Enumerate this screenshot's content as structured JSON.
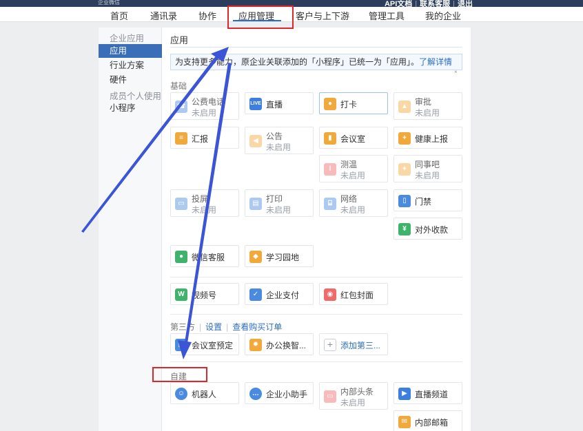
{
  "topbar": {
    "logo": "企业微信",
    "links": [
      "API文档",
      "联系客服",
      "退出"
    ]
  },
  "nav": {
    "items": [
      "首页",
      "通讯录",
      "协作",
      "应用管理",
      "客户与上下游",
      "管理工具",
      "我的企业"
    ],
    "active": "应用管理"
  },
  "sidebar": {
    "group1_header": "企业应用",
    "items1": [
      "应用",
      "行业方案",
      "硬件"
    ],
    "group2_header": "成员个人使用",
    "items2": [
      "小程序"
    ]
  },
  "main": {
    "title": "应用",
    "notice_text": "为支持更多能力，原企业关联添加的「小程序」已统一为「应用」。",
    "notice_link": "了解详情",
    "notice_close": "×",
    "section_basic": "基础",
    "basic_apps": [
      {
        "name": "公费电话",
        "status": "未启用",
        "icon": "phone-icon",
        "color": "#4a8be0"
      },
      {
        "name": "直播",
        "status": "",
        "icon": "live-icon",
        "color": "#3d7fe0"
      },
      {
        "name": "打卡",
        "status": "",
        "icon": "location-pin-icon",
        "color": "#f2a93b"
      },
      {
        "name": "审批",
        "status": "未启用",
        "icon": "approval-icon",
        "color": "#f2a93b"
      },
      {
        "name": "汇报",
        "status": "",
        "icon": "report-icon",
        "color": "#f2a93b"
      },
      {
        "name": "公告",
        "status": "未启用",
        "icon": "announcement-icon",
        "color": "#f2a93b"
      },
      {
        "name": "会议室",
        "status": "",
        "icon": "meeting-room-icon",
        "color": "#f2a93b"
      },
      {
        "name": "健康上报",
        "status": "",
        "icon": "health-icon",
        "color": "#f2a93b"
      },
      {
        "name": "测温",
        "status": "未启用",
        "icon": "thermometer-icon",
        "color": "#ef6b6b"
      },
      {
        "name": "同事吧",
        "status": "未启用",
        "icon": "colleagues-icon",
        "color": "#f2a93b"
      },
      {
        "name": "投屏",
        "status": "未启用",
        "icon": "screencast-icon",
        "color": "#4a8be0"
      },
      {
        "name": "打印",
        "status": "未启用",
        "icon": "printer-icon",
        "color": "#4a8be0"
      },
      {
        "name": "网络",
        "status": "未启用",
        "icon": "network-icon",
        "color": "#4a8be0"
      },
      {
        "name": "门禁",
        "status": "",
        "icon": "door-icon",
        "color": "#4a8be0"
      },
      {
        "name": "对外收款",
        "status": "",
        "icon": "payment-icon",
        "color": "#3fb36b"
      },
      {
        "name": "微信客服",
        "status": "",
        "icon": "customer-service-icon",
        "color": "#3fb36b"
      },
      {
        "name": "学习园地",
        "status": "",
        "icon": "learning-icon",
        "color": "#f2a93b"
      }
    ],
    "wechat_apps": [
      {
        "name": "视频号",
        "icon": "channels-icon",
        "color": "#3fb36b"
      },
      {
        "name": "企业支付",
        "icon": "enterprise-pay-icon",
        "color": "#4a8be0"
      },
      {
        "name": "红包封面",
        "icon": "red-envelope-icon",
        "color": "#ef6b6b"
      }
    ],
    "third_party": {
      "label": "第三方",
      "settings_link": "设置",
      "purchase_link": "查看购买订单",
      "apps": [
        {
          "name": "会议室预定",
          "icon": "booking-icon",
          "color": "#4a8be0"
        },
        {
          "name": "办公换智...",
          "icon": "bulb-icon",
          "color": "#f2a93b"
        },
        {
          "name": "添加第三...",
          "icon": "plus-icon",
          "color": "#ffffff"
        }
      ]
    },
    "section_custom": "自建",
    "custom_apps": [
      {
        "name": "机器人",
        "status": "",
        "icon": "robot-icon",
        "color": "#4a8be0"
      },
      {
        "name": "企业小助手",
        "status": "",
        "icon": "chat-bubble-icon",
        "color": "#4a8be0"
      },
      {
        "name": "内部头条",
        "status": "未启用",
        "icon": "headline-icon",
        "color": "#ef6b6b"
      },
      {
        "name": "直播频道",
        "status": "",
        "icon": "tv-icon",
        "color": "#3d7fe0"
      },
      {
        "name": "内部邮箱",
        "status": "",
        "icon": "mail-icon",
        "color": "#f2a93b"
      }
    ]
  },
  "annotations": {
    "highlight_color": "#e0262a",
    "arrow_color": "#3b55d6"
  }
}
